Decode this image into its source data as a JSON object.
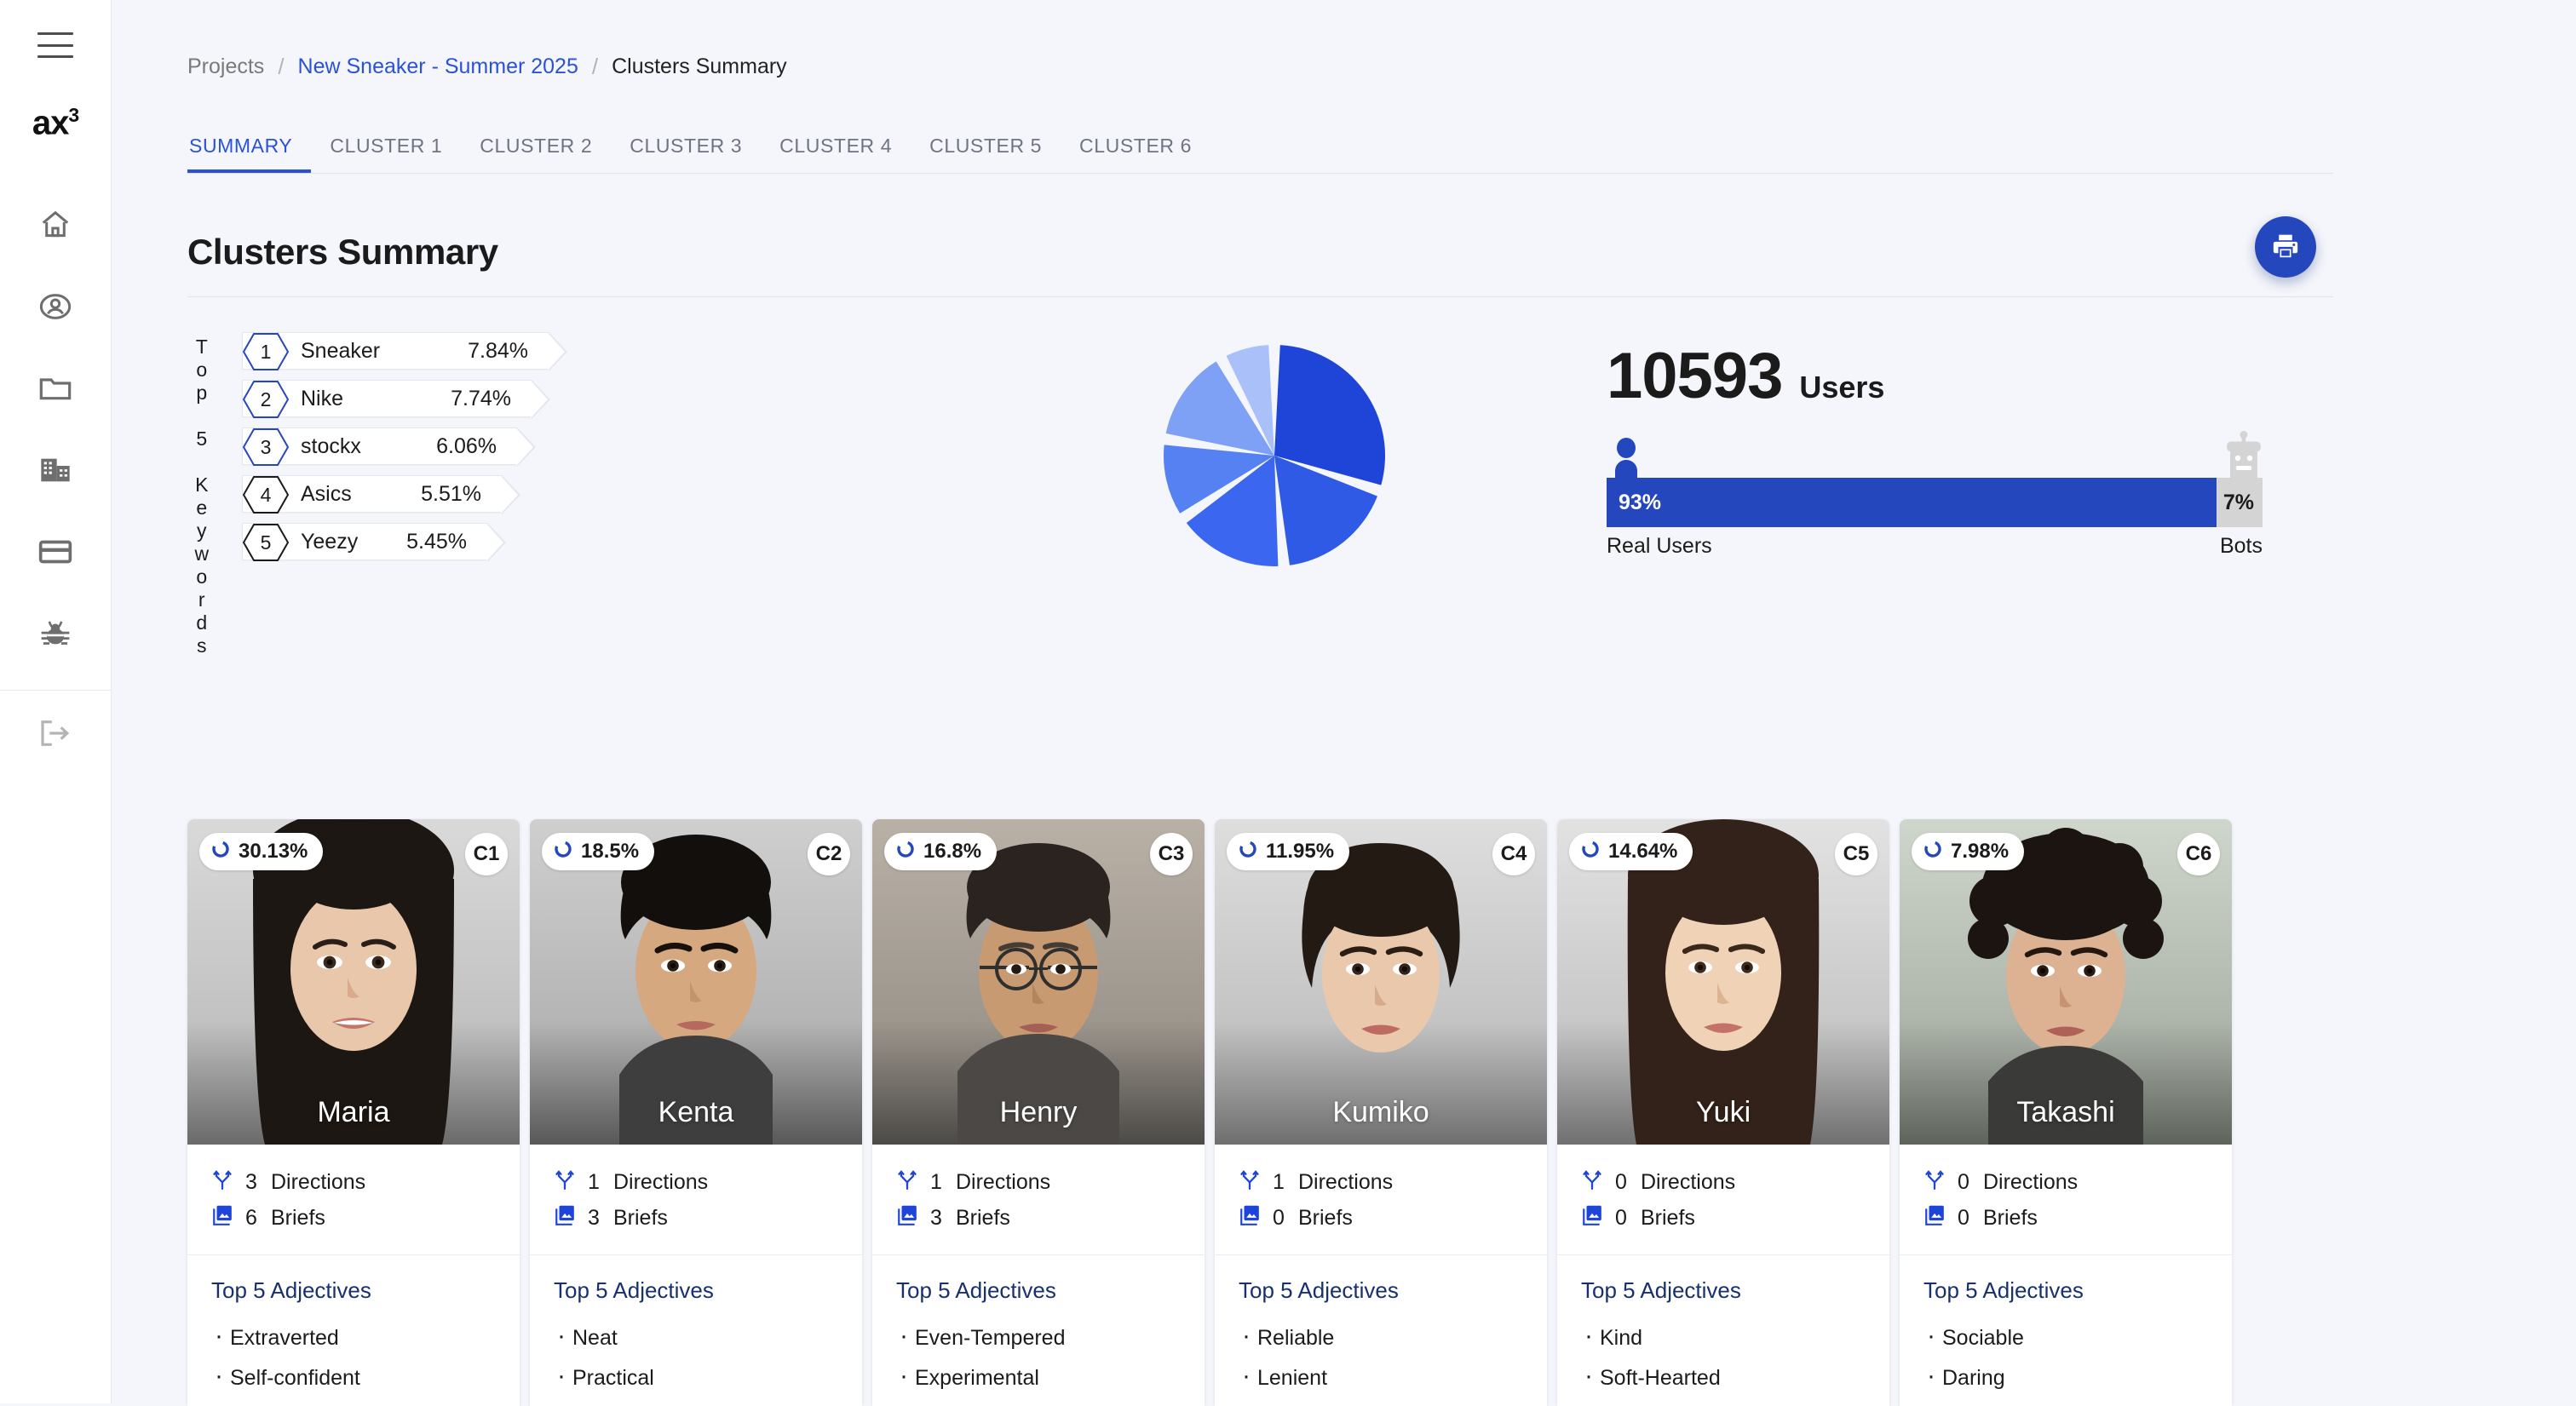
{
  "sidebar": {
    "brand": "ax",
    "brand_sup": "3",
    "items": [
      {
        "icon": "home-icon",
        "label": "Home"
      },
      {
        "icon": "account-icon",
        "label": "Account"
      },
      {
        "icon": "folder-icon",
        "label": "Projects"
      },
      {
        "icon": "building-icon",
        "label": "Company"
      },
      {
        "icon": "card-icon",
        "label": "Billing"
      },
      {
        "icon": "bug-icon",
        "label": "Debug"
      }
    ],
    "logout": {
      "icon": "logout-icon",
      "label": "Logout"
    },
    "menu_icon": "hamburger-icon"
  },
  "breadcrumb": {
    "root": "Projects",
    "project": "New Sneaker - Summer 2025",
    "current": "Clusters Summary",
    "separator": "/"
  },
  "tabs": [
    {
      "label": "SUMMARY",
      "active": true
    },
    {
      "label": "CLUSTER 1",
      "active": false
    },
    {
      "label": "CLUSTER 2",
      "active": false
    },
    {
      "label": "CLUSTER 3",
      "active": false
    },
    {
      "label": "CLUSTER 4",
      "active": false
    },
    {
      "label": "CLUSTER 5",
      "active": false
    },
    {
      "label": "CLUSTER 6",
      "active": false
    }
  ],
  "page": {
    "title": "Clusters Summary",
    "print_button_icon": "printer-icon",
    "accent_color": "#2547bd"
  },
  "keywords_panel": {
    "vertical_label": "Top 5 Keywords",
    "items": [
      {
        "rank": "1",
        "term": "Sneaker",
        "percent": "7.84%",
        "highlight": true
      },
      {
        "rank": "2",
        "term": "Nike",
        "percent": "7.74%",
        "highlight": true
      },
      {
        "rank": "3",
        "term": "stockx",
        "percent": "6.06%",
        "highlight": true
      },
      {
        "rank": "4",
        "term": "Asics",
        "percent": "5.51%",
        "highlight": false
      },
      {
        "rank": "5",
        "term": "Yeezy",
        "percent": "5.45%",
        "highlight": false
      }
    ]
  },
  "users_panel": {
    "count": "10593",
    "count_label": "Users",
    "real_percent": "93%",
    "bots_percent": "7%",
    "real_label": "Real Users",
    "bots_label": "Bots",
    "real_color": "#2547bd",
    "bots_color": "#d4d4d4",
    "person_icon": "person-icon",
    "bot_icon": "robot-icon"
  },
  "clusters": [
    {
      "id": "C1",
      "name": "Maria",
      "percent": "30.13%",
      "directions": "3",
      "directions_label": "Directions",
      "briefs": "6",
      "briefs_label": "Briefs",
      "adjectives_title": "Top 5 Adjectives",
      "adjectives": [
        "Extraverted",
        "Self-confident"
      ],
      "photo_top": "#d9d9d9",
      "photo_bottom": "#6a6a6a",
      "hair": "#1d1713",
      "skin": "#e8c7ab"
    },
    {
      "id": "C2",
      "name": "Kenta",
      "percent": "18.5%",
      "directions": "1",
      "directions_label": "Directions",
      "briefs": "3",
      "briefs_label": "Briefs",
      "adjectives_title": "Top 5 Adjectives",
      "adjectives": [
        "Neat",
        "Practical"
      ],
      "photo_top": "#cfcfcf",
      "photo_bottom": "#585858",
      "hair": "#120f0c",
      "skin": "#d6a87f"
    },
    {
      "id": "C3",
      "name": "Henry",
      "percent": "16.8%",
      "directions": "1",
      "directions_label": "Directions",
      "briefs": "3",
      "briefs_label": "Briefs",
      "adjectives_title": "Top 5 Adjectives",
      "adjectives": [
        "Even-Tempered",
        "Experimental"
      ],
      "photo_top": "#b9b1a6",
      "photo_bottom": "#4c4a47",
      "hair": "#2a2320",
      "skin": "#c89a72"
    },
    {
      "id": "C4",
      "name": "Kumiko",
      "percent": "11.95%",
      "directions": "1",
      "directions_label": "Directions",
      "briefs": "0",
      "briefs_label": "Briefs",
      "adjectives_title": "Top 5 Adjectives",
      "adjectives": [
        "Reliable",
        "Lenient"
      ],
      "photo_top": "#dedede",
      "photo_bottom": "#6f6f6f",
      "hair": "#241a14",
      "skin": "#eac8ab"
    },
    {
      "id": "C5",
      "name": "Yuki",
      "percent": "14.64%",
      "directions": "0",
      "directions_label": "Directions",
      "briefs": "0",
      "briefs_label": "Briefs",
      "adjectives_title": "Top 5 Adjectives",
      "adjectives": [
        "Kind",
        "Soft-Hearted"
      ],
      "photo_top": "#e2e2e2",
      "photo_bottom": "#707070",
      "hair": "#332219",
      "skin": "#f0d2b6"
    },
    {
      "id": "C6",
      "name": "Takashi",
      "percent": "7.98%",
      "directions": "0",
      "directions_label": "Directions",
      "briefs": "0",
      "briefs_label": "Briefs",
      "adjectives_title": "Top 5 Adjectives",
      "adjectives": [
        "Sociable",
        "Daring"
      ],
      "photo_top": "#cfd6cc",
      "photo_bottom": "#5e635c",
      "hair": "#1b1410",
      "skin": "#dcb292"
    }
  ],
  "chart_data": {
    "type": "pie",
    "title": "",
    "labels": [
      "C1",
      "C2",
      "C3",
      "C4",
      "C5",
      "C6"
    ],
    "values": [
      30.13,
      18.5,
      16.8,
      11.95,
      14.64,
      7.98
    ],
    "unit": "%",
    "colors": [
      "#1f44d8",
      "#2f5ae6",
      "#3b66ef",
      "#5681f2",
      "#7ea1f5",
      "#a9c0f8"
    ],
    "start_angle": 0,
    "slice_gap": true,
    "legend": "none"
  }
}
